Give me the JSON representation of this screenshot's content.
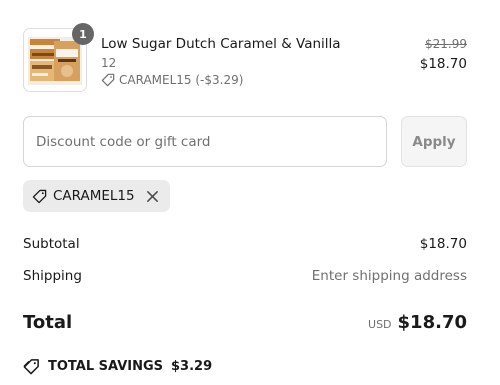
{
  "product": {
    "quantity": "1",
    "title": "Low Sugar Dutch Caramel & Vanilla",
    "variant": "12",
    "discount_label": "CARAMEL15 (-$3.29)",
    "original_price": "$21.99",
    "price": "$18.70",
    "image_icon": "product-box-image"
  },
  "discount_form": {
    "placeholder": "Discount code or gift card",
    "value": "",
    "apply_label": "Apply"
  },
  "applied_code": {
    "code": "CARAMEL15",
    "icon": "tag-icon",
    "remove_icon": "close-icon"
  },
  "summary": {
    "subtotal_label": "Subtotal",
    "subtotal_value": "$18.70",
    "shipping_label": "Shipping",
    "shipping_value": "Enter shipping address"
  },
  "total": {
    "label": "Total",
    "currency": "USD",
    "amount": "$18.70"
  },
  "savings": {
    "label": "TOTAL SAVINGS",
    "amount": "$3.29",
    "icon": "tag-icon"
  },
  "colors": {
    "badge": "#666666",
    "muted_text": "#707070",
    "chip_bg": "#ebebeb",
    "apply_bg": "#f5f5f5"
  }
}
